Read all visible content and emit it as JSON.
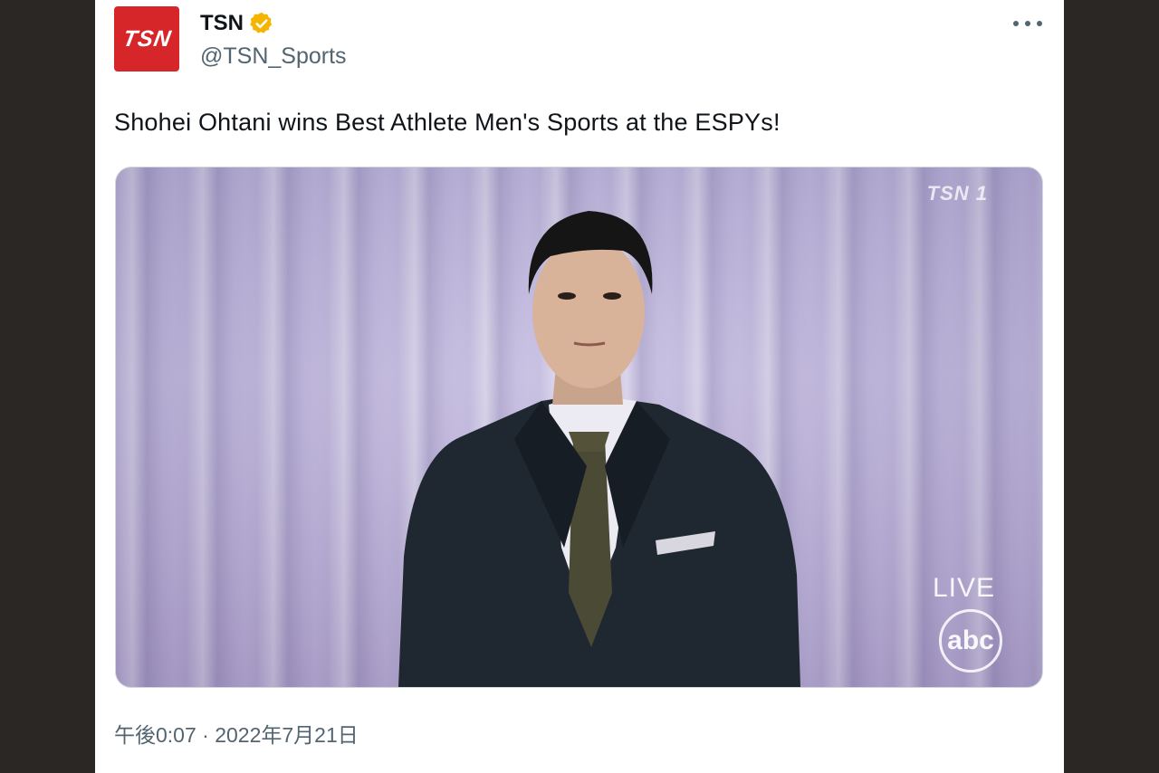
{
  "author": {
    "display_name": "TSN",
    "handle": "@TSN_Sports",
    "avatar_text": "TSN",
    "verified": true,
    "verified_color": "#f4b400"
  },
  "tweet": {
    "text": "Shohei Ohtani wins Best Athlete Men's Sports at the ESPYs!",
    "timestamp": "午後0:07 · 2022年7月21日"
  },
  "media": {
    "channel_watermark": "TSN 1",
    "live_label": "LIVE",
    "network_logo": "abc"
  },
  "icons": {
    "more": "more-horizontal-icon",
    "verified": "verified-badge-icon"
  },
  "colors": {
    "brand": "#d7262a",
    "text_primary": "#0f1419",
    "text_secondary": "#536471"
  }
}
